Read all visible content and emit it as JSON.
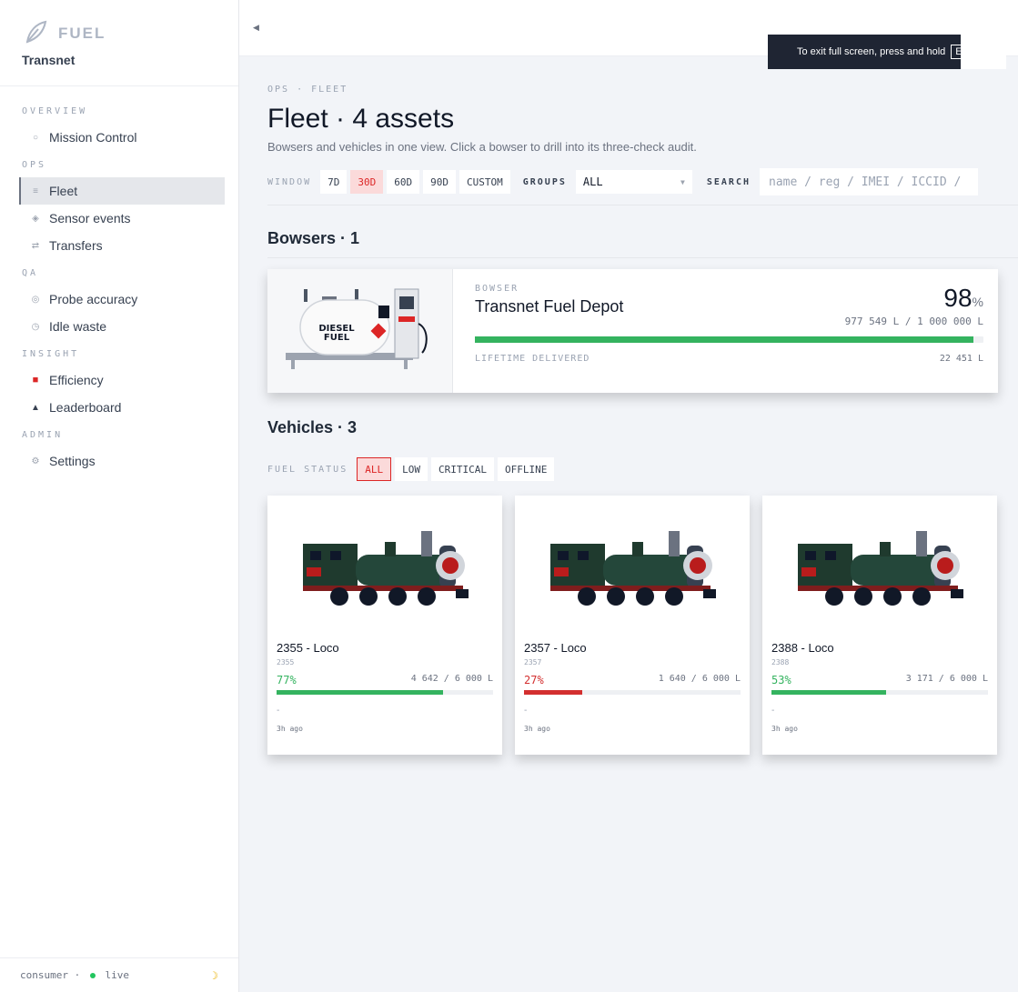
{
  "brand": {
    "name": "FUEL",
    "org": "Transnet"
  },
  "nav": {
    "sections": [
      {
        "label": "OVERVIEW",
        "items": [
          {
            "label": "Mission Control",
            "icon": "circle-outline-icon"
          }
        ]
      },
      {
        "label": "OPS",
        "items": [
          {
            "label": "Fleet",
            "icon": "list-icon",
            "active": true
          },
          {
            "label": "Sensor events",
            "icon": "diamond-icon"
          },
          {
            "label": "Transfers",
            "icon": "arrows-icon"
          }
        ]
      },
      {
        "label": "QA",
        "items": [
          {
            "label": "Probe accuracy",
            "icon": "target-icon"
          },
          {
            "label": "Idle waste",
            "icon": "clock-icon"
          }
        ]
      },
      {
        "label": "INSIGHT",
        "items": [
          {
            "label": "Efficiency",
            "icon": "fuel-icon"
          },
          {
            "label": "Leaderboard",
            "icon": "triangle-icon"
          }
        ]
      },
      {
        "label": "ADMIN",
        "items": [
          {
            "label": "Settings",
            "icon": "gear-icon"
          }
        ]
      }
    ]
  },
  "footer": {
    "mode": "consumer",
    "separator": "·",
    "status": "live"
  },
  "toast": {
    "text": "To exit full screen, press and hold",
    "key": "E"
  },
  "page": {
    "breadcrumb": "OPS · FLEET",
    "title": "Fleet · 4 assets",
    "subtitle": "Bowsers and vehicles in one view. Click a bowser to drill into its three-check audit."
  },
  "filters": {
    "window_label": "WINDOW",
    "windows": [
      "7D",
      "30D",
      "60D",
      "90D",
      "CUSTOM"
    ],
    "active_window": "30D",
    "groups_label": "GROUPS",
    "groups_value": "ALL",
    "search_label": "SEARCH",
    "search_placeholder": "name / reg / IMEI / ICCID /"
  },
  "bowsers": {
    "title": "Bowsers · 1",
    "items": [
      {
        "kicker": "BOWSER",
        "name": "Transnet Fuel Depot",
        "percent": "98",
        "percent_unit": "%",
        "volume": "977 549 L / 1 000 000 L",
        "fill_fraction": 0.98,
        "lifetime_label": "LIFETIME DELIVERED",
        "lifetime_value": "22 451 L",
        "image_text": [
          "DIESEL",
          "FUEL"
        ]
      }
    ]
  },
  "vehicles": {
    "title": "Vehicles · 3",
    "status_label": "FUEL STATUS",
    "statuses": [
      "ALL",
      "LOW",
      "CRITICAL",
      "OFFLINE"
    ],
    "active_status": "ALL",
    "items": [
      {
        "name": "2355 - Loco",
        "id": "2355",
        "percent": "77%",
        "volume": "4 642 / 6 000 L",
        "fill_fraction": 0.77,
        "color": "#34b35f",
        "note": "-",
        "updated": "3h ago"
      },
      {
        "name": "2357 - Loco",
        "id": "2357",
        "percent": "27%",
        "volume": "1 640 / 6 000 L",
        "fill_fraction": 0.27,
        "color": "#d32f2f",
        "note": "-",
        "updated": "3h ago"
      },
      {
        "name": "2388 - Loco",
        "id": "2388",
        "percent": "53%",
        "volume": "3 171 / 6 000 L",
        "fill_fraction": 0.53,
        "color": "#34b35f",
        "note": "-",
        "updated": "3h ago"
      }
    ]
  },
  "colors": {
    "accent": "#dc2626",
    "good": "#34b35f",
    "bad": "#d32f2f"
  }
}
